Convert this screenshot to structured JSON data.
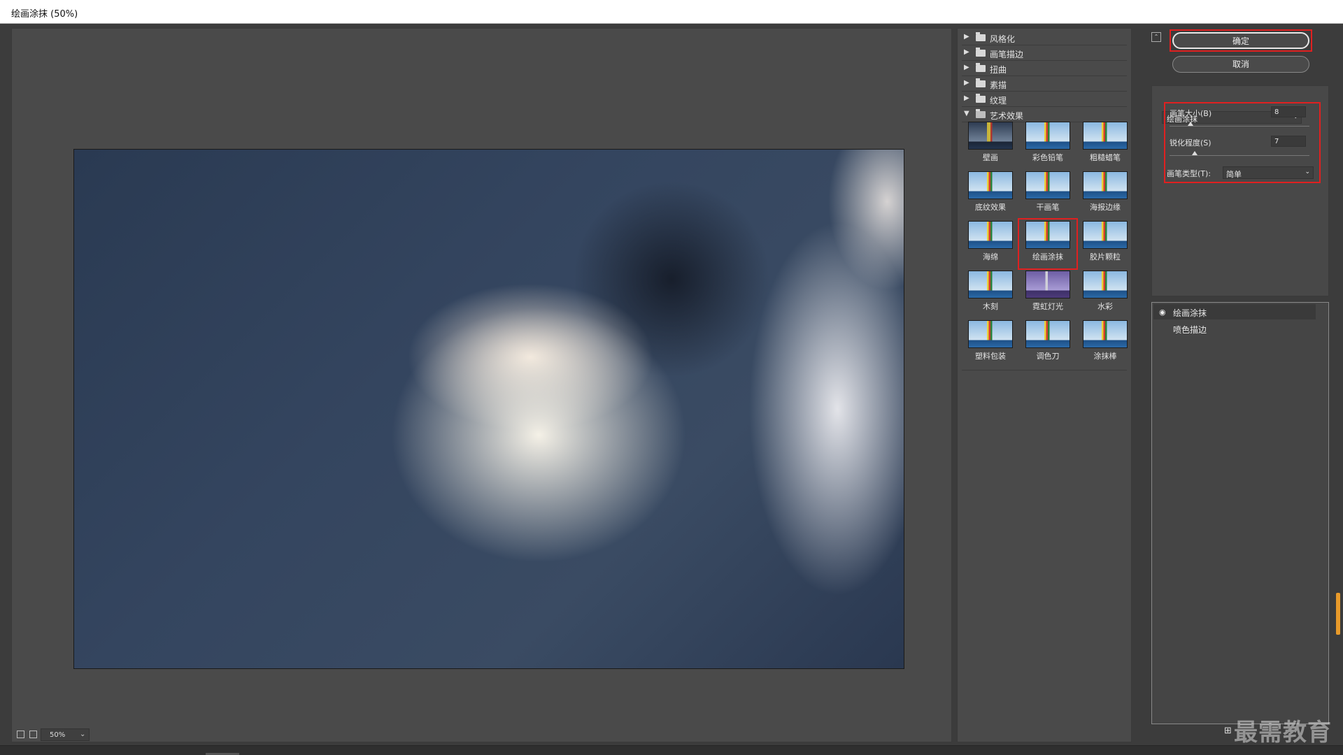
{
  "window": {
    "title": "绘画涂抹 (50%)"
  },
  "preview": {
    "zoom": "50%"
  },
  "gallery": {
    "folders": [
      {
        "label": "风格化",
        "expanded": false
      },
      {
        "label": "画笔描边",
        "expanded": false
      },
      {
        "label": "扭曲",
        "expanded": false
      },
      {
        "label": "素描",
        "expanded": false
      },
      {
        "label": "纹理",
        "expanded": false
      },
      {
        "label": "艺术效果",
        "expanded": true
      }
    ],
    "thumbnails": [
      {
        "label": "壁画"
      },
      {
        "label": "彩色铅笔"
      },
      {
        "label": "粗糙蜡笔"
      },
      {
        "label": "底纹效果"
      },
      {
        "label": "干画笔"
      },
      {
        "label": "海报边缘"
      },
      {
        "label": "海绵"
      },
      {
        "label": "绘画涂抹"
      },
      {
        "label": "胶片颗粒"
      },
      {
        "label": "木刻"
      },
      {
        "label": "霓虹灯光"
      },
      {
        "label": "水彩"
      },
      {
        "label": "塑料包装"
      },
      {
        "label": "调色刀"
      },
      {
        "label": "涂抹棒"
      }
    ]
  },
  "buttons": {
    "ok": "确定",
    "cancel": "取消"
  },
  "settings": {
    "filter": "绘画涂抹",
    "brush_size": {
      "label": "画笔大小(B)",
      "value": "8"
    },
    "sharpness": {
      "label": "锐化程度(S)",
      "value": "7"
    },
    "brush_type": {
      "label": "画笔类型(T):",
      "value": "简单"
    }
  },
  "layers": [
    {
      "name": "绘画涂抹",
      "visible": true
    },
    {
      "name": "喷色描边",
      "visible": false
    }
  ],
  "watermark": "最需教育",
  "colors": {
    "highlight": "#e02020",
    "panel": "#4a4a4a",
    "background": "#3c3c3c"
  }
}
